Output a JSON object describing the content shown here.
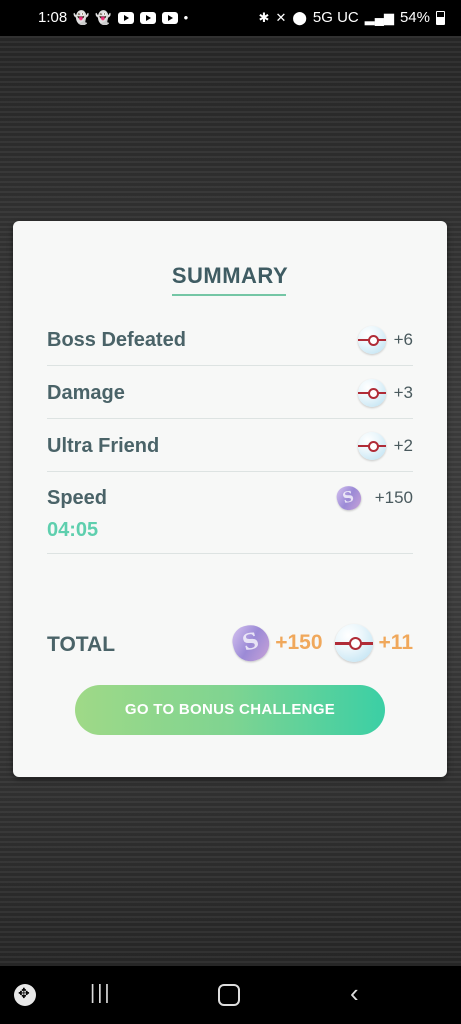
{
  "status_bar": {
    "time": "1:08",
    "network": "5G UC",
    "battery": "54%"
  },
  "summary": {
    "title": "SUMMARY",
    "rows": [
      {
        "label": "Boss Defeated",
        "icon": "premier-ball-icon",
        "value": "+6"
      },
      {
        "label": "Damage",
        "icon": "premier-ball-icon",
        "value": "+3"
      },
      {
        "label": "Ultra Friend",
        "icon": "premier-ball-icon",
        "value": "+2"
      },
      {
        "label": "Speed",
        "sub": "04:05",
        "icon": "stardust-icon",
        "value": "+150"
      }
    ],
    "total": {
      "label": "TOTAL",
      "stardust": "+150",
      "balls": "+11"
    },
    "button_label": "GO TO BONUS CHALLENGE"
  },
  "colors": {
    "title": "#3f5c63",
    "accent_green": "#5ecfae",
    "total_orange": "#f0a85b"
  }
}
